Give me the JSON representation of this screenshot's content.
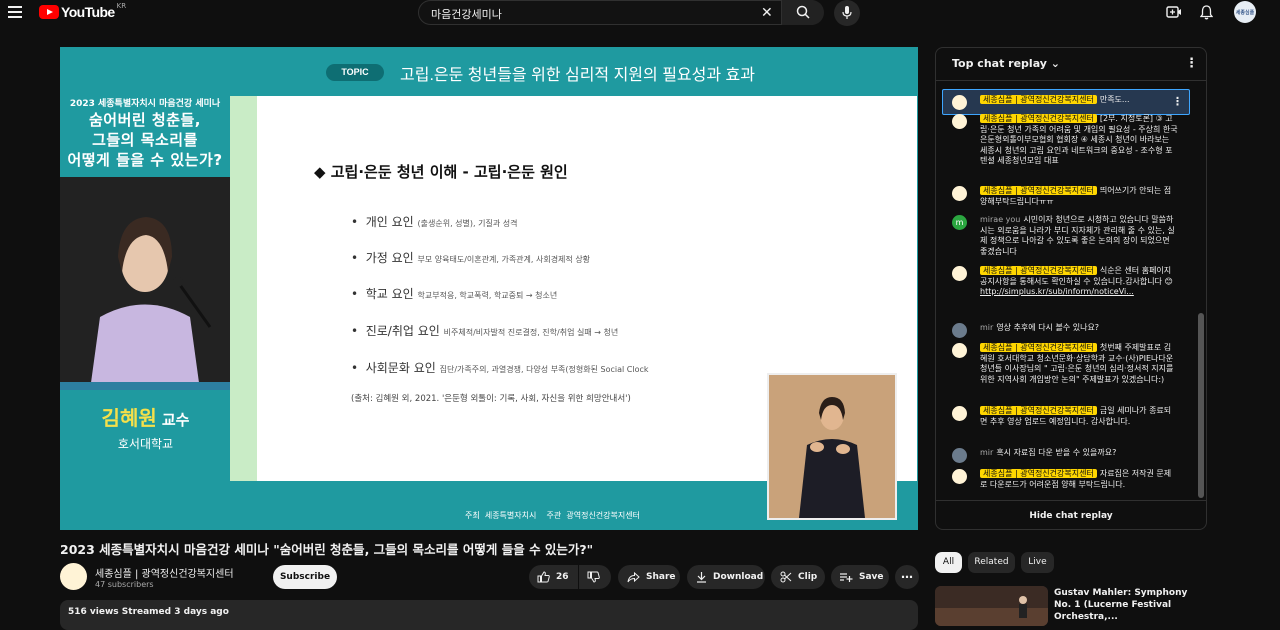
{
  "header": {
    "logo_text": "YouTube",
    "region": "KR",
    "search_query": "마음건강세미나",
    "avatar_text": "세종심플"
  },
  "video": {
    "topic_label": "TOPIC",
    "topic_title": "고립.은둔 청년들을 위한 심리적 지원의 필요성과 효과",
    "left_small": "2023 세종특별자치시 마음건강 세미나",
    "left_big_1": "숨어버린 청춘들,",
    "left_big_2": "그들의 목소리를",
    "left_big_3": "어떻게 들을 수 있는가?",
    "speaker_name": "김혜원",
    "speaker_role": "교수",
    "speaker_univ": "호서대학교",
    "slide": {
      "heading": "◆  고립·은둔 청년 이해 - 고립·은둔 원인",
      "items": [
        {
          "label": "개인 요인",
          "detail": "(출생순위, 성별), 기질과 성격"
        },
        {
          "label": "가정 요인",
          "detail": "부모 양육태도/이혼관계, 가족관계, 사회경제적 상황"
        },
        {
          "label": "학교 요인",
          "detail": "학교부적응, 학교폭력, 학교중퇴 → 청소년"
        },
        {
          "label": "진로/취업 요인",
          "detail": "비주체적/비자발적 진로결정, 진학/취업 실패 → 청년"
        },
        {
          "label": "사회문화 요인",
          "detail": "집단/가족주의, 과열경쟁, 다양성 부족(정형화된 Social Clock"
        }
      ],
      "source": "(출처: 김혜원 외, 2021. '은둔형 외톨이: 기록, 사회, 자신을 위한 희망안내서')"
    },
    "footer_host_1": "주최",
    "footer_host_org1": "세종특별자치시",
    "footer_host_2": "주관",
    "footer_host_org2": "광역정신건강복지센터"
  },
  "chat": {
    "header_label": "Top chat replay",
    "hide_label": "Hide chat replay",
    "messages": [
      {
        "author": "세종심플 | 광역정신건강복지센터",
        "owner": true,
        "text": "만족도..."
      },
      {
        "author": "세종심플 | 광역정신건강복지센터",
        "owner": true,
        "text": "[2부. 지정토론] ③ 고립·은둔 청년 가족의 어려움 및 개입의 필요성 - 주상희 한국은둔형외톨이부모협회 협회장 ④ 세종시 청년이 바라보는 세종시 청년의 고립 요인과 네트워크의 중요성 - 조수형 포텐셜 세종청년모임 대표"
      },
      {
        "author": "세종심플 | 광역정신건강복지센터",
        "owner": true,
        "text": "띄어쓰기가 안되는 점 양해부탁드립니다ㅠㅠ"
      },
      {
        "author": "mirae you",
        "owner": false,
        "text": "시민이자 청년으로 시청하고 있습니다 말씀하시는 외로움을 나라가 부디 지자체가 관리해 줄 수 있는, 실제 정책으로 나아갈 수 있도록 좋은 논의의 장이 되었으면 좋겠습니다"
      },
      {
        "author": "세종심플 | 광역정신건강복지센터",
        "owner": true,
        "text": "식순은 센터 홈페이지 공지사항을 통해서도 확인하실 수 있습니다.감사합니다",
        "link": "http://simplus.kr/sub/inform/noticeVi..."
      },
      {
        "author": "mir",
        "owner": false,
        "text": "영상 추후에 다시 볼수 있나요?"
      },
      {
        "author": "세종심플 | 광역정신건강복지센터",
        "owner": true,
        "text": "첫번째 주제발표로 김혜원 호서대학교 청소년문화·상담학과 교수·(사)PIE나다운청년들 이사장님의 \" 고립·은둔 청년의 심리·정서적 지지를 위한 지역사회 개입방안 논의\" 주제발표가 있겠습니다:)"
      },
      {
        "author": "세종심플 | 광역정신건강복지센터",
        "owner": true,
        "text": "금일 세미나가 종료되면 추후 영상 업로드 예정입니다. 감사합니다."
      },
      {
        "author": "mir",
        "owner": false,
        "text": "혹시 자료집 다운 받을 수 있을까요?"
      },
      {
        "author": "세종심플 | 광역정신건강복지센터",
        "owner": true,
        "text": "자료집은 저작권 문제로 다운로드가 어려운점 양해 부탁드립니다."
      }
    ]
  },
  "below": {
    "title": "2023 세종특별자치시 마음건강 세미나 \"숨어버린 청춘들, 그들의 목소리를 어떻게 들을 수 있는가?\"",
    "channel_name": "세종심플 | 광역정신건강복지센터",
    "subscribers": "47 subscribers",
    "subscribe_label": "Subscribe",
    "like_count": "26",
    "share_label": "Share",
    "download_label": "Download",
    "clip_label": "Clip",
    "save_label": "Save",
    "views_line": "516 views  Streamed 3 days ago"
  },
  "sidebar": {
    "chips": [
      "All",
      "Related",
      "Live"
    ],
    "rec_title": "Gustav Mahler: Symphony No. 1 (Lucerne Festival Orchestra,..."
  },
  "colors": {
    "accent_teal": "#1f9aa0",
    "badge_yellow": "#ffd600",
    "brand_red": "#ff0000"
  }
}
